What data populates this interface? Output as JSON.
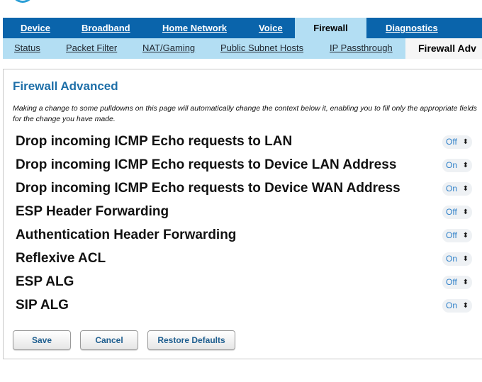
{
  "brand": {
    "accent": "#0a64ab",
    "light": "#b3def3",
    "title_color": "#1e6fa8",
    "option_color": "#2d7fc8"
  },
  "main_nav": [
    {
      "label": "Device",
      "active": false
    },
    {
      "label": "Broadband",
      "active": false
    },
    {
      "label": "Home Network",
      "active": false
    },
    {
      "label": "Voice",
      "active": false
    },
    {
      "label": "Firewall",
      "active": true
    },
    {
      "label": "Diagnostics",
      "active": false
    }
  ],
  "sub_nav": [
    {
      "label": "Status",
      "active": false
    },
    {
      "label": "Packet Filter",
      "active": false
    },
    {
      "label": "NAT/Gaming",
      "active": false
    },
    {
      "label": "Public Subnet Hosts",
      "active": false
    },
    {
      "label": "IP Passthrough",
      "active": false
    },
    {
      "label": "Firewall Adv",
      "active": true
    }
  ],
  "page": {
    "title": "Firewall Advanced",
    "help_text": "Making a change to some pulldowns on this page will automatically change the context below it, enabling you to fill only the appropriate fields for the change you have made."
  },
  "settings": [
    {
      "label": "Drop incoming ICMP Echo requests to LAN",
      "value": "Off"
    },
    {
      "label": "Drop incoming ICMP Echo requests to Device LAN Address",
      "value": "On"
    },
    {
      "label": "Drop incoming ICMP Echo requests to Device WAN Address",
      "value": "On"
    },
    {
      "label": "ESP Header Forwarding",
      "value": "Off"
    },
    {
      "label": "Authentication Header Forwarding",
      "value": "Off"
    },
    {
      "label": "Reflexive ACL",
      "value": "On"
    },
    {
      "label": "ESP ALG",
      "value": "Off"
    },
    {
      "label": "SIP ALG",
      "value": "On"
    }
  ],
  "buttons": {
    "save": "Save",
    "cancel": "Cancel",
    "restore": "Restore Defaults"
  },
  "icons": {
    "dropdown": "chevron-updown-icon",
    "logo": "globe-logo-icon"
  }
}
